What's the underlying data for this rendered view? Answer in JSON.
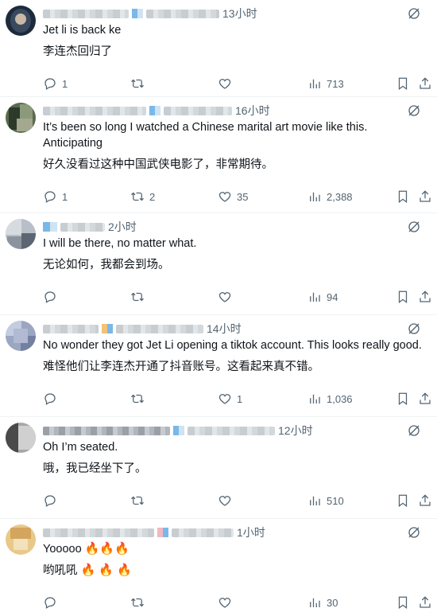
{
  "replies": [
    {
      "time": "13小时",
      "text": "Jet li is back ke",
      "translation": "李连杰回归了",
      "counts": {
        "reply": "1",
        "retweet": "",
        "like": "",
        "views": "713"
      }
    },
    {
      "time": "16小时",
      "text": "It’s been so long I watched a Chinese marital art movie like this. Anticipating",
      "translation": "好久没看过这种中国武侠电影了，非常期待。",
      "counts": {
        "reply": "1",
        "retweet": "2",
        "like": "35",
        "views": "2,388"
      }
    },
    {
      "time": "2小时",
      "text": "I will be there, no matter what.",
      "translation": "无论如何，我都会到场。",
      "counts": {
        "reply": "",
        "retweet": "",
        "like": "",
        "views": "94"
      }
    },
    {
      "time": "14小时",
      "text": "No wonder they got Jet Li opening a tiktok account. This looks really good.",
      "translation": "难怪他们让李连杰开通了抖音账号。这看起来真不错。",
      "counts": {
        "reply": "",
        "retweet": "",
        "like": "1",
        "views": "1,036"
      }
    },
    {
      "time": "12小时",
      "text": "Oh I’m seated.",
      "translation": "哦，我已经坐下了。",
      "counts": {
        "reply": "",
        "retweet": "",
        "like": "",
        "views": "510"
      }
    },
    {
      "time": "1小时",
      "text": "Yooooo",
      "text_emoji": "🔥🔥🔥",
      "translation": "哟吼吼",
      "translation_emoji": "🔥  🔥  🔥",
      "counts": {
        "reply": "",
        "retweet": "",
        "like": "",
        "views": "30"
      }
    }
  ]
}
